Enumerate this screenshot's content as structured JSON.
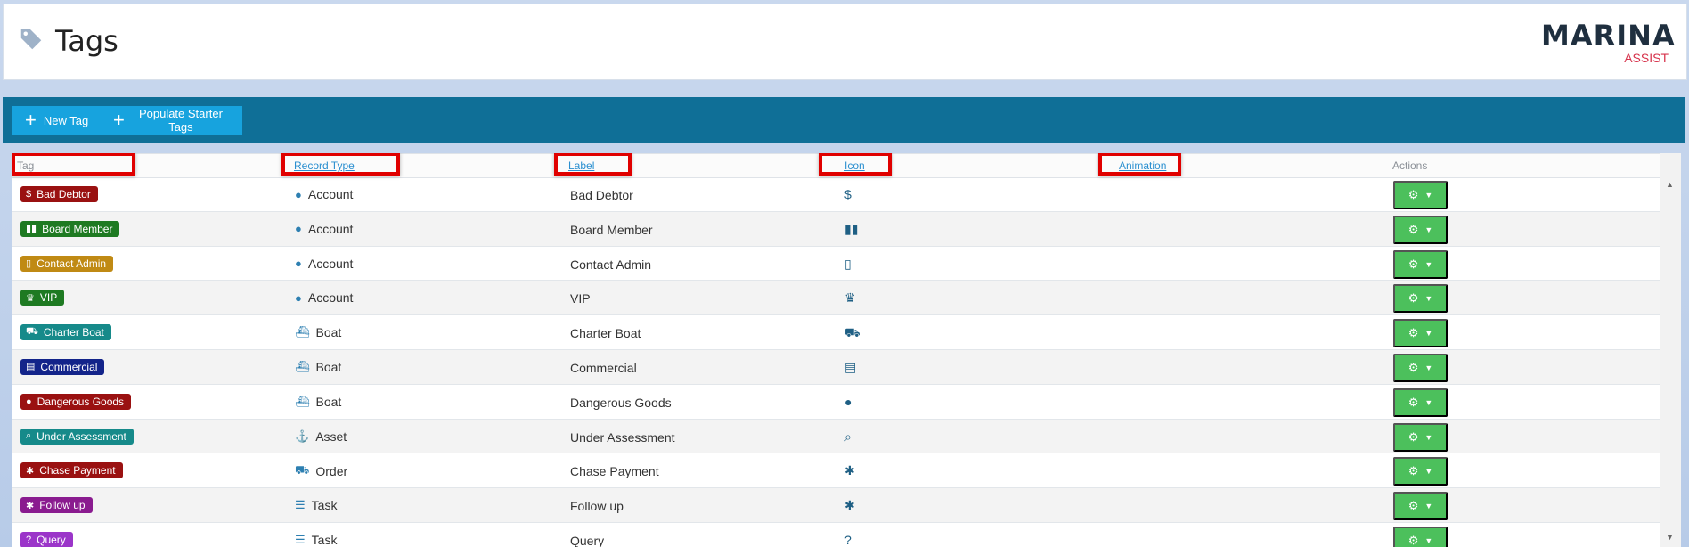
{
  "page": {
    "title": "Tags",
    "title_icon": "tag-icon"
  },
  "logo": {
    "main": "MARINA",
    "sub": "ASSIST"
  },
  "toolbar": {
    "new_tag_label": "New Tag",
    "populate_label": "Populate Starter Tags"
  },
  "columns": {
    "tag": "Tag",
    "record_type": "Record Type",
    "label": "Label",
    "icon": "Icon",
    "animation": "Animation",
    "actions": "Actions"
  },
  "rows": [
    {
      "tag": "Bad Debtor",
      "tag_color": "#9a1111",
      "tag_icon": "hand-dollar-icon",
      "record_type": "Account",
      "record_icon": "user-icon",
      "label": "Bad Debtor",
      "icon": "hand-dollar-icon"
    },
    {
      "tag": "Board Member",
      "tag_color": "#1e7a22",
      "tag_icon": "people-group-icon",
      "record_type": "Account",
      "record_icon": "user-icon",
      "label": "Board Member",
      "icon": "people-group-icon"
    },
    {
      "tag": "Contact Admin",
      "tag_color": "#c08a14",
      "tag_icon": "phone-icon",
      "record_type": "Account",
      "record_icon": "user-icon",
      "label": "Contact Admin",
      "icon": "phone-icon"
    },
    {
      "tag": "VIP",
      "tag_color": "#1e7a22",
      "tag_icon": "crown-icon",
      "record_type": "Account",
      "record_icon": "user-icon",
      "label": "VIP",
      "icon": "crown-icon"
    },
    {
      "tag": "Charter Boat",
      "tag_color": "#168a8a",
      "tag_icon": "truck-icon",
      "record_type": "Boat",
      "record_icon": "ship-icon",
      "label": "Charter Boat",
      "icon": "truck-icon"
    },
    {
      "tag": "Commercial",
      "tag_color": "#13248a",
      "tag_icon": "warehouse-icon",
      "record_type": "Boat",
      "record_icon": "ship-icon",
      "label": "Commercial",
      "icon": "warehouse-icon"
    },
    {
      "tag": "Dangerous Goods",
      "tag_color": "#9a1111",
      "tag_icon": "bomb-icon",
      "record_type": "Boat",
      "record_icon": "ship-icon",
      "label": "Dangerous Goods",
      "icon": "bomb-icon"
    },
    {
      "tag": "Under Assessment",
      "tag_color": "#168a8a",
      "tag_icon": "magnifier-icon",
      "record_type": "Asset",
      "record_icon": "anchor-icon",
      "label": "Under Assessment",
      "icon": "magnifier-icon"
    },
    {
      "tag": "Chase Payment",
      "tag_color": "#9a1111",
      "tag_icon": "running-icon",
      "record_type": "Order",
      "record_icon": "cart-icon",
      "label": "Chase Payment",
      "icon": "running-icon"
    },
    {
      "tag": "Follow up",
      "tag_color": "#8a1b8f",
      "tag_icon": "running-icon",
      "record_type": "Task",
      "record_icon": "tasks-icon",
      "label": "Follow up",
      "icon": "running-icon"
    },
    {
      "tag": "Query",
      "tag_color": "#9b35c9",
      "tag_icon": "question-circle-icon",
      "record_type": "Task",
      "record_icon": "tasks-icon",
      "label": "Query",
      "icon": "question-circle-icon"
    }
  ],
  "colors": {
    "toolbar_bg": "#0f6f97",
    "button_bg": "#17a3de",
    "action_button_bg": "#4cc05c",
    "link": "#2a8fd0",
    "highlight_box": "#e00000"
  }
}
